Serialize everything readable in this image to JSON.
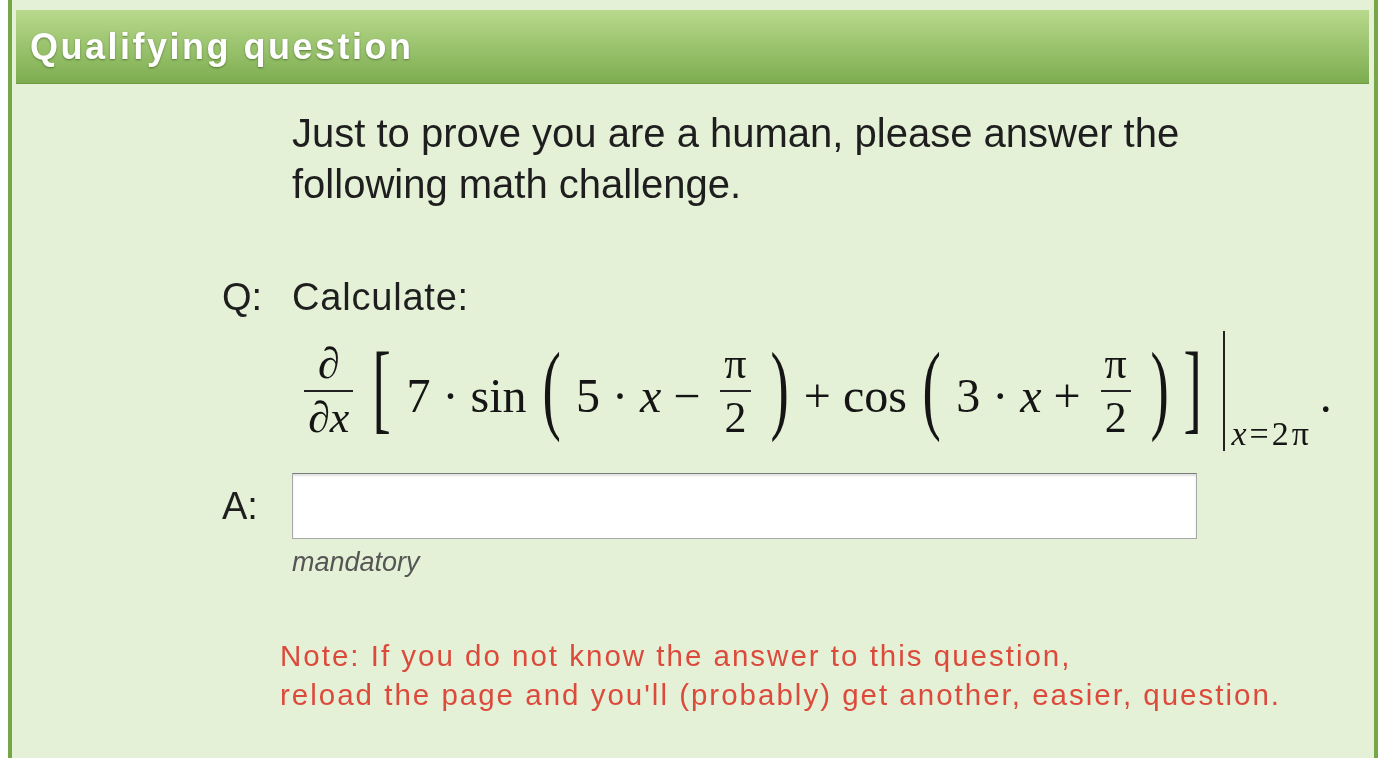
{
  "panel": {
    "title": "Qualifying question",
    "intro": "Just to prove you are a human, please answer the following math challenge."
  },
  "question": {
    "label": "Q:",
    "prompt": "Calculate:",
    "formula": [
      {
        "kind": "frac",
        "num": "∂",
        "den": "∂*x*"
      },
      {
        "kind": "delim",
        "text": "["
      },
      {
        "kind": "text",
        "text": "7 · sin"
      },
      {
        "kind": "delim",
        "text": "("
      },
      {
        "kind": "text",
        "text": "5 · *x* −"
      },
      {
        "kind": "frac",
        "num": "π",
        "den": "2"
      },
      {
        "kind": "delim",
        "text": ")"
      },
      {
        "kind": "text",
        "text": "+ cos"
      },
      {
        "kind": "delim",
        "text": "("
      },
      {
        "kind": "text",
        "text": "3 · *x* +"
      },
      {
        "kind": "frac",
        "num": "π",
        "den": "2"
      },
      {
        "kind": "delim",
        "text": ")"
      },
      {
        "kind": "delim",
        "text": "]"
      },
      {
        "kind": "eval",
        "text": "*x*=2π"
      },
      {
        "kind": "text",
        "text": "."
      }
    ]
  },
  "answer": {
    "label": "A:",
    "hint": "mandatory"
  },
  "note": "Note: If you do not know the answer to this question,\nreload the page and you'll (probably) get another, easier, question."
}
